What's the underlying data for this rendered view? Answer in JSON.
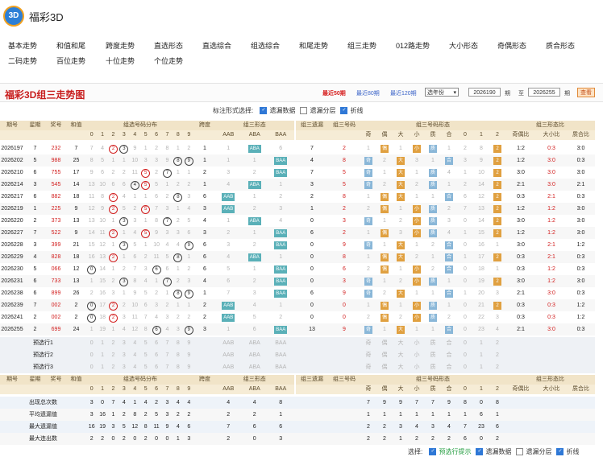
{
  "site": {
    "name": "福彩3D",
    "logo_text": "3D"
  },
  "nav_row1": [
    "基本走势",
    "和值和尾",
    "跨度走势",
    "直选形态",
    "直选综合",
    "组选综合",
    "和尾走势",
    "组三走势",
    "012路走势",
    "大小形态",
    "奇偶形态",
    "质合形态"
  ],
  "nav_row2": [
    "二码走势",
    "百位走势",
    "十位走势",
    "个位走势"
  ],
  "page_title": "福彩3D组三走势图",
  "periods": [
    "最近50期",
    "最近80期",
    "最近120期"
  ],
  "select_label": "选年份",
  "range": {
    "from": "2026190",
    "to": "2026255",
    "unit": "期",
    "to_label": "至",
    "button": "查看"
  },
  "options_top": {
    "label": "标注形式选择:",
    "items": [
      {
        "label": "遗漏数据",
        "checked": true
      },
      {
        "label": "遗漏分层",
        "checked": false
      },
      {
        "label": "折线",
        "checked": true
      }
    ]
  },
  "options_bottom": {
    "label": "选择:",
    "items": [
      {
        "label": "预选行提示",
        "checked": true,
        "green": true
      },
      {
        "label": "遗漏数据",
        "checked": true
      },
      {
        "label": "遗漏分层",
        "checked": false
      },
      {
        "label": "折线",
        "checked": true
      }
    ]
  },
  "headers": {
    "period": "期号",
    "sort_mark": "▾",
    "weekday": "星期",
    "number": "奖号",
    "sum": "和值",
    "dist_group": "组选号码分布",
    "span": "跨度",
    "form_group": "组三形态",
    "form_cols": [
      "AAB",
      "ABA",
      "BAA"
    ],
    "miss": "组三遗漏",
    "code": "组三号码",
    "shape_group": "组三号码形态",
    "shape_cols": [
      "奇",
      "偶",
      "大",
      "小",
      "质",
      "合",
      "0",
      "1",
      "2"
    ],
    "ratio_group": "组三形态比",
    "ratio_cols": [
      "奇偶比",
      "大小比",
      "质合比"
    ],
    "digits": [
      "0",
      "1",
      "2",
      "3",
      "4",
      "5",
      "6",
      "7",
      "8",
      "9"
    ]
  },
  "rows": [
    {
      "period": "2026197",
      "week": "7",
      "num": "232",
      "sum": "7",
      "dist": [
        "7",
        "4",
        "②",
        "③",
        "9",
        "1",
        "2",
        "8",
        "1",
        "2"
      ],
      "span": "1",
      "form": [
        "1",
        "ABA",
        "6"
      ],
      "miss": "7",
      "code": "2",
      "shape": [
        "1",
        "偶",
        "1",
        "小",
        "质",
        "1",
        "2",
        "8",
        "2"
      ],
      "ratio": [
        "1:2",
        "0:3",
        "3:0"
      ]
    },
    {
      "period": "2026202",
      "week": "5",
      "num": "988",
      "sum": "25",
      "dist": [
        "8",
        "5",
        "1",
        "1",
        "10",
        "3",
        "3",
        "9",
        "⑧",
        "⑨"
      ],
      "span": "1",
      "form": [
        "1",
        "1",
        "BAA"
      ],
      "miss": "4",
      "code": "8",
      "shape": [
        "奇",
        "2",
        "大",
        "3",
        "1",
        "合",
        "3",
        "9",
        "2"
      ],
      "ratio": [
        "1:2",
        "3:0",
        "0:3"
      ]
    },
    {
      "period": "2026210",
      "week": "6",
      "num": "755",
      "sum": "17",
      "dist": [
        "9",
        "6",
        "2",
        "2",
        "11",
        "⑤",
        "2",
        "⑦",
        "1",
        "1"
      ],
      "span": "2",
      "form": [
        "3",
        "2",
        "BAA"
      ],
      "miss": "7",
      "code": "5",
      "shape": [
        "奇",
        "1",
        "大",
        "1",
        "质",
        "4",
        "1",
        "10",
        "2"
      ],
      "ratio": [
        "3:0",
        "3:0",
        "3:0"
      ]
    },
    {
      "period": "2026214",
      "week": "3",
      "num": "545",
      "sum": "14",
      "dist": [
        "13",
        "10",
        "6",
        "6",
        "④",
        "⑤",
        "5",
        "1",
        "2",
        "2"
      ],
      "span": "1",
      "form": [
        "4",
        "ABA",
        "1"
      ],
      "miss": "3",
      "code": "5",
      "shape": [
        "奇",
        "2",
        "大",
        "2",
        "质",
        "1",
        "2",
        "14",
        "2"
      ],
      "ratio": [
        "2:1",
        "3:0",
        "2:1"
      ]
    },
    {
      "period": "2026217",
      "week": "6",
      "num": "882",
      "sum": "18",
      "dist": [
        "11",
        "8",
        "②",
        "4",
        "1",
        "1",
        "6",
        "2",
        "⑧",
        "3"
      ],
      "span": "6",
      "form": [
        "AAB",
        "1",
        "2"
      ],
      "miss": "2",
      "code": "8",
      "shape": [
        "1",
        "偶",
        "大",
        "1",
        "1",
        "合",
        "6",
        "12",
        "2"
      ],
      "ratio": [
        "0:3",
        "2:1",
        "0:3"
      ]
    },
    {
      "period": "2026219",
      "week": "1",
      "num": "225",
      "sum": "9",
      "dist": [
        "12",
        "9",
        "②",
        "5",
        "2",
        "⑤",
        "7",
        "3",
        "1",
        "4"
      ],
      "span": "3",
      "form": [
        "AAB",
        "2",
        "3"
      ],
      "miss": "1",
      "code": "2",
      "shape": [
        "2",
        "偶",
        "1",
        "小",
        "质",
        "2",
        "7",
        "13",
        "2"
      ],
      "ratio": [
        "1:2",
        "1:2",
        "3:0"
      ]
    },
    {
      "period": "2026220",
      "week": "2",
      "num": "373",
      "sum": "13",
      "dist": [
        "13",
        "10",
        "1",
        "③",
        "3",
        "1",
        "8",
        "⑦",
        "2",
        "5"
      ],
      "span": "4",
      "form": [
        "1",
        "ABA",
        "4"
      ],
      "miss": "0",
      "code": "3",
      "shape": [
        "奇",
        "1",
        "2",
        "小",
        "质",
        "3",
        "0",
        "14",
        "2"
      ],
      "ratio": [
        "3:0",
        "1:2",
        "3:0"
      ]
    },
    {
      "period": "2026227",
      "week": "7",
      "num": "522",
      "sum": "9",
      "dist": [
        "14",
        "11",
        "②",
        "1",
        "4",
        "⑤",
        "9",
        "3",
        "3",
        "6"
      ],
      "span": "3",
      "form": [
        "2",
        "1",
        "BAA"
      ],
      "miss": "6",
      "code": "2",
      "shape": [
        "1",
        "偶",
        "3",
        "小",
        "质",
        "4",
        "1",
        "15",
        "2"
      ],
      "ratio": [
        "1:2",
        "1:2",
        "3:0"
      ]
    },
    {
      "period": "2026228",
      "week": "3",
      "num": "399",
      "sum": "21",
      "dist": [
        "15",
        "12",
        "1",
        "③",
        "5",
        "1",
        "10",
        "4",
        "4",
        "⑨"
      ],
      "span": "6",
      "form": [
        "3",
        "2",
        "BAA"
      ],
      "miss": "0",
      "code": "9",
      "shape": [
        "奇",
        "1",
        "大",
        "1",
        "2",
        "合",
        "0",
        "16",
        "1"
      ],
      "ratio": [
        "3:0",
        "2:1",
        "1:2"
      ]
    },
    {
      "period": "2026229",
      "week": "4",
      "num": "828",
      "sum": "18",
      "dist": [
        "16",
        "13",
        "②",
        "1",
        "6",
        "2",
        "11",
        "5",
        "⑧",
        "1"
      ],
      "span": "6",
      "form": [
        "4",
        "ABA",
        "1"
      ],
      "miss": "0",
      "code": "8",
      "shape": [
        "1",
        "偶",
        "大",
        "2",
        "1",
        "合",
        "1",
        "17",
        "2"
      ],
      "ratio": [
        "0:3",
        "2:1",
        "0:3"
      ]
    },
    {
      "period": "2026230",
      "week": "5",
      "num": "066",
      "sum": "12",
      "dist": [
        "⓪",
        "14",
        "1",
        "2",
        "7",
        "3",
        "⑥",
        "6",
        "1",
        "2"
      ],
      "span": "6",
      "form": [
        "5",
        "1",
        "BAA"
      ],
      "miss": "0",
      "code": "6",
      "shape": [
        "2",
        "偶",
        "1",
        "小",
        "2",
        "合",
        "0",
        "18",
        "1"
      ],
      "ratio": [
        "0:3",
        "1:2",
        "0:3"
      ]
    },
    {
      "period": "2026231",
      "week": "6",
      "num": "733",
      "sum": "13",
      "dist": [
        "1",
        "15",
        "2",
        "③",
        "8",
        "4",
        "1",
        "⑦",
        "2",
        "3"
      ],
      "span": "4",
      "form": [
        "6",
        "2",
        "BAA"
      ],
      "miss": "0",
      "code": "3",
      "shape": [
        "奇",
        "1",
        "2",
        "小",
        "质",
        "1",
        "0",
        "19",
        "2"
      ],
      "ratio": [
        "3:0",
        "1:2",
        "3:0"
      ]
    },
    {
      "period": "2026238",
      "week": "6",
      "num": "899",
      "sum": "26",
      "dist": [
        "2",
        "16",
        "3",
        "1",
        "9",
        "5",
        "2",
        "1",
        "⑧",
        "⑨"
      ],
      "span": "1",
      "form": [
        "7",
        "3",
        "BAA"
      ],
      "miss": "6",
      "code": "9",
      "shape": [
        "奇",
        "2",
        "大",
        "1",
        "1",
        "合",
        "1",
        "20",
        "3"
      ],
      "ratio": [
        "2:1",
        "3:0",
        "0:3"
      ]
    },
    {
      "period": "2026239",
      "week": "7",
      "num": "002",
      "sum": "2",
      "dist": [
        "⓪",
        "17",
        "②",
        "2",
        "10",
        "6",
        "3",
        "2",
        "1",
        "1"
      ],
      "span": "2",
      "form": [
        "AAB",
        "4",
        "1"
      ],
      "miss": "0",
      "code": "0",
      "shape": [
        "1",
        "偶",
        "1",
        "小",
        "质",
        "1",
        "0",
        "21",
        "2"
      ],
      "ratio": [
        "0:3",
        "0:3",
        "1:2"
      ]
    },
    {
      "period": "2026241",
      "week": "2",
      "num": "002",
      "sum": "2",
      "dist": [
        "⓪",
        "18",
        "②",
        "3",
        "11",
        "7",
        "4",
        "3",
        "2",
        "2"
      ],
      "span": "2",
      "form": [
        "AAB",
        "5",
        "2"
      ],
      "miss": "0",
      "code": "0",
      "shape": [
        "2",
        "偶",
        "2",
        "小",
        "质",
        "2",
        "0",
        "22",
        "3"
      ],
      "ratio": [
        "0:3",
        "0:3",
        "1:2"
      ]
    },
    {
      "period": "2026255",
      "week": "2",
      "num": "699",
      "sum": "24",
      "dist": [
        "1",
        "19",
        "1",
        "4",
        "12",
        "8",
        "⑥",
        "4",
        "3",
        "⑨"
      ],
      "span": "3",
      "form": [
        "1",
        "6",
        "BAA"
      ],
      "miss": "13",
      "code": "9",
      "shape": [
        "奇",
        "1",
        "大",
        "1",
        "1",
        "合",
        "0",
        "23",
        "4"
      ],
      "ratio": [
        "2:1",
        "3:0",
        "0:3"
      ]
    }
  ],
  "preselect": [
    "预选行1",
    "预选行2",
    "预选行3"
  ],
  "stats": [
    {
      "label": "出现总次数",
      "dist": [
        "3",
        "0",
        "7",
        "4",
        "1",
        "4",
        "2",
        "3",
        "4",
        "4"
      ],
      "form": [
        "4",
        "4",
        "8"
      ],
      "shape": [
        "7",
        "9",
        "9",
        "7",
        "7",
        "9",
        "8",
        "0",
        "8"
      ]
    },
    {
      "label": "平均遗漏值",
      "dist": [
        "3",
        "16",
        "1",
        "2",
        "8",
        "2",
        "5",
        "3",
        "2",
        "2"
      ],
      "form": [
        "2",
        "2",
        "1"
      ],
      "shape": [
        "1",
        "1",
        "1",
        "1",
        "1",
        "1",
        "1",
        "6",
        "1"
      ]
    },
    {
      "label": "最大遗漏值",
      "dist": [
        "16",
        "19",
        "3",
        "5",
        "12",
        "8",
        "11",
        "9",
        "4",
        "6"
      ],
      "form": [
        "7",
        "6",
        "6"
      ],
      "shape": [
        "2",
        "2",
        "3",
        "4",
        "3",
        "4",
        "7",
        "23",
        "6"
      ]
    },
    {
      "label": "最大连出数",
      "dist": [
        "2",
        "2",
        "0",
        "2",
        "0",
        "2",
        "0",
        "0",
        "1",
        "3"
      ],
      "form": [
        "2",
        "0",
        "3"
      ],
      "shape": [
        "2",
        "2",
        "1",
        "2",
        "2",
        "2",
        "6",
        "0",
        "2"
      ]
    }
  ]
}
